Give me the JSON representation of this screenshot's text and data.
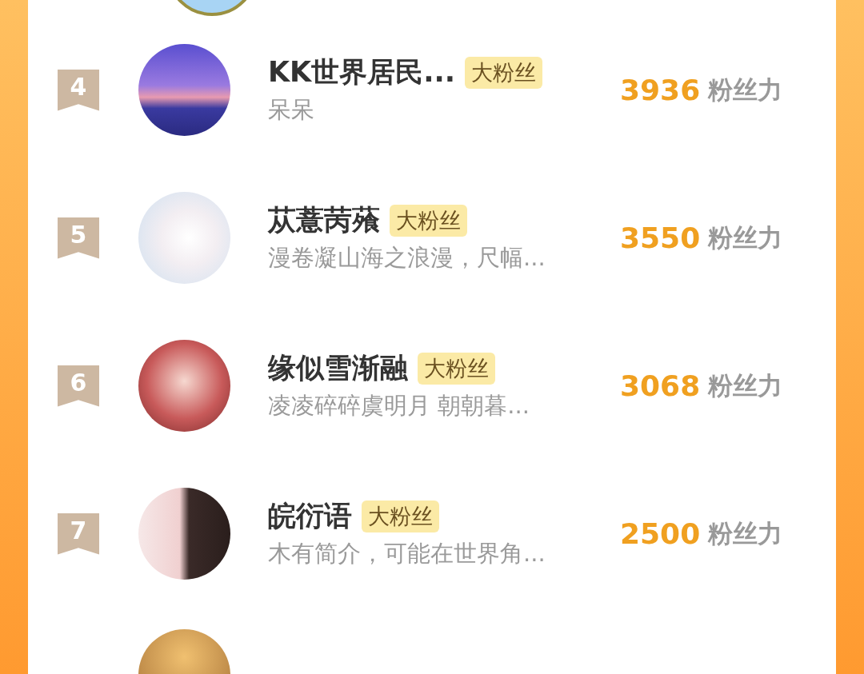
{
  "ranking": [
    {
      "rank": "4",
      "name": "KK世界居民...",
      "badge": "大粉丝",
      "bio": "呆呆",
      "score": "3936",
      "unit": "粉丝力"
    },
    {
      "rank": "5",
      "name": "苁薏苪蕵",
      "badge": "大粉丝",
      "bio": "漫卷凝山海之浪漫，尺幅...",
      "score": "3550",
      "unit": "粉丝力"
    },
    {
      "rank": "6",
      "name": "缘似雪渐融",
      "badge": "大粉丝",
      "bio": "凌凌碎碎虞明月 朝朝暮...",
      "score": "3068",
      "unit": "粉丝力"
    },
    {
      "rank": "7",
      "name": "皖衍语",
      "badge": "大粉丝",
      "bio": "木有简介，可能在世界角...",
      "score": "2500",
      "unit": "粉丝力"
    }
  ]
}
